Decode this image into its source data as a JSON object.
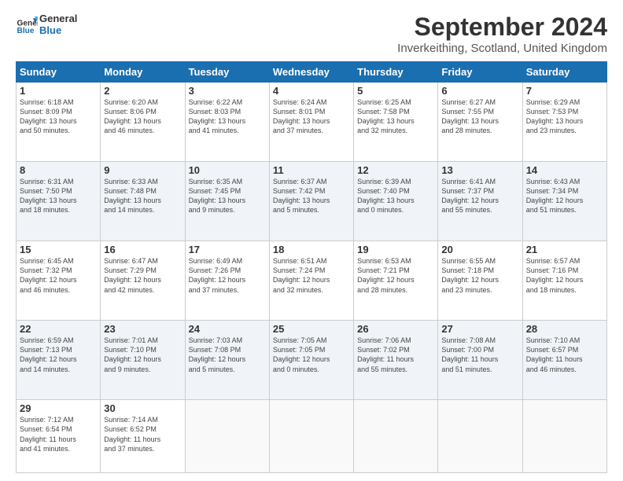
{
  "header": {
    "logo_line1": "General",
    "logo_line2": "Blue",
    "title": "September 2024",
    "subtitle": "Inverkeithing, Scotland, United Kingdom"
  },
  "weekdays": [
    "Sunday",
    "Monday",
    "Tuesday",
    "Wednesday",
    "Thursday",
    "Friday",
    "Saturday"
  ],
  "weeks": [
    [
      {
        "day": "1",
        "info": "Sunrise: 6:18 AM\nSunset: 8:09 PM\nDaylight: 13 hours\nand 50 minutes."
      },
      {
        "day": "2",
        "info": "Sunrise: 6:20 AM\nSunset: 8:06 PM\nDaylight: 13 hours\nand 46 minutes."
      },
      {
        "day": "3",
        "info": "Sunrise: 6:22 AM\nSunset: 8:03 PM\nDaylight: 13 hours\nand 41 minutes."
      },
      {
        "day": "4",
        "info": "Sunrise: 6:24 AM\nSunset: 8:01 PM\nDaylight: 13 hours\nand 37 minutes."
      },
      {
        "day": "5",
        "info": "Sunrise: 6:25 AM\nSunset: 7:58 PM\nDaylight: 13 hours\nand 32 minutes."
      },
      {
        "day": "6",
        "info": "Sunrise: 6:27 AM\nSunset: 7:55 PM\nDaylight: 13 hours\nand 28 minutes."
      },
      {
        "day": "7",
        "info": "Sunrise: 6:29 AM\nSunset: 7:53 PM\nDaylight: 13 hours\nand 23 minutes."
      }
    ],
    [
      {
        "day": "8",
        "info": "Sunrise: 6:31 AM\nSunset: 7:50 PM\nDaylight: 13 hours\nand 18 minutes."
      },
      {
        "day": "9",
        "info": "Sunrise: 6:33 AM\nSunset: 7:48 PM\nDaylight: 13 hours\nand 14 minutes."
      },
      {
        "day": "10",
        "info": "Sunrise: 6:35 AM\nSunset: 7:45 PM\nDaylight: 13 hours\nand 9 minutes."
      },
      {
        "day": "11",
        "info": "Sunrise: 6:37 AM\nSunset: 7:42 PM\nDaylight: 13 hours\nand 5 minutes."
      },
      {
        "day": "12",
        "info": "Sunrise: 6:39 AM\nSunset: 7:40 PM\nDaylight: 13 hours\nand 0 minutes."
      },
      {
        "day": "13",
        "info": "Sunrise: 6:41 AM\nSunset: 7:37 PM\nDaylight: 12 hours\nand 55 minutes."
      },
      {
        "day": "14",
        "info": "Sunrise: 6:43 AM\nSunset: 7:34 PM\nDaylight: 12 hours\nand 51 minutes."
      }
    ],
    [
      {
        "day": "15",
        "info": "Sunrise: 6:45 AM\nSunset: 7:32 PM\nDaylight: 12 hours\nand 46 minutes."
      },
      {
        "day": "16",
        "info": "Sunrise: 6:47 AM\nSunset: 7:29 PM\nDaylight: 12 hours\nand 42 minutes."
      },
      {
        "day": "17",
        "info": "Sunrise: 6:49 AM\nSunset: 7:26 PM\nDaylight: 12 hours\nand 37 minutes."
      },
      {
        "day": "18",
        "info": "Sunrise: 6:51 AM\nSunset: 7:24 PM\nDaylight: 12 hours\nand 32 minutes."
      },
      {
        "day": "19",
        "info": "Sunrise: 6:53 AM\nSunset: 7:21 PM\nDaylight: 12 hours\nand 28 minutes."
      },
      {
        "day": "20",
        "info": "Sunrise: 6:55 AM\nSunset: 7:18 PM\nDaylight: 12 hours\nand 23 minutes."
      },
      {
        "day": "21",
        "info": "Sunrise: 6:57 AM\nSunset: 7:16 PM\nDaylight: 12 hours\nand 18 minutes."
      }
    ],
    [
      {
        "day": "22",
        "info": "Sunrise: 6:59 AM\nSunset: 7:13 PM\nDaylight: 12 hours\nand 14 minutes."
      },
      {
        "day": "23",
        "info": "Sunrise: 7:01 AM\nSunset: 7:10 PM\nDaylight: 12 hours\nand 9 minutes."
      },
      {
        "day": "24",
        "info": "Sunrise: 7:03 AM\nSunset: 7:08 PM\nDaylight: 12 hours\nand 5 minutes."
      },
      {
        "day": "25",
        "info": "Sunrise: 7:05 AM\nSunset: 7:05 PM\nDaylight: 12 hours\nand 0 minutes."
      },
      {
        "day": "26",
        "info": "Sunrise: 7:06 AM\nSunset: 7:02 PM\nDaylight: 11 hours\nand 55 minutes."
      },
      {
        "day": "27",
        "info": "Sunrise: 7:08 AM\nSunset: 7:00 PM\nDaylight: 11 hours\nand 51 minutes."
      },
      {
        "day": "28",
        "info": "Sunrise: 7:10 AM\nSunset: 6:57 PM\nDaylight: 11 hours\nand 46 minutes."
      }
    ],
    [
      {
        "day": "29",
        "info": "Sunrise: 7:12 AM\nSunset: 6:54 PM\nDaylight: 11 hours\nand 41 minutes."
      },
      {
        "day": "30",
        "info": "Sunrise: 7:14 AM\nSunset: 6:52 PM\nDaylight: 11 hours\nand 37 minutes."
      },
      {
        "day": "",
        "info": ""
      },
      {
        "day": "",
        "info": ""
      },
      {
        "day": "",
        "info": ""
      },
      {
        "day": "",
        "info": ""
      },
      {
        "day": "",
        "info": ""
      }
    ]
  ]
}
